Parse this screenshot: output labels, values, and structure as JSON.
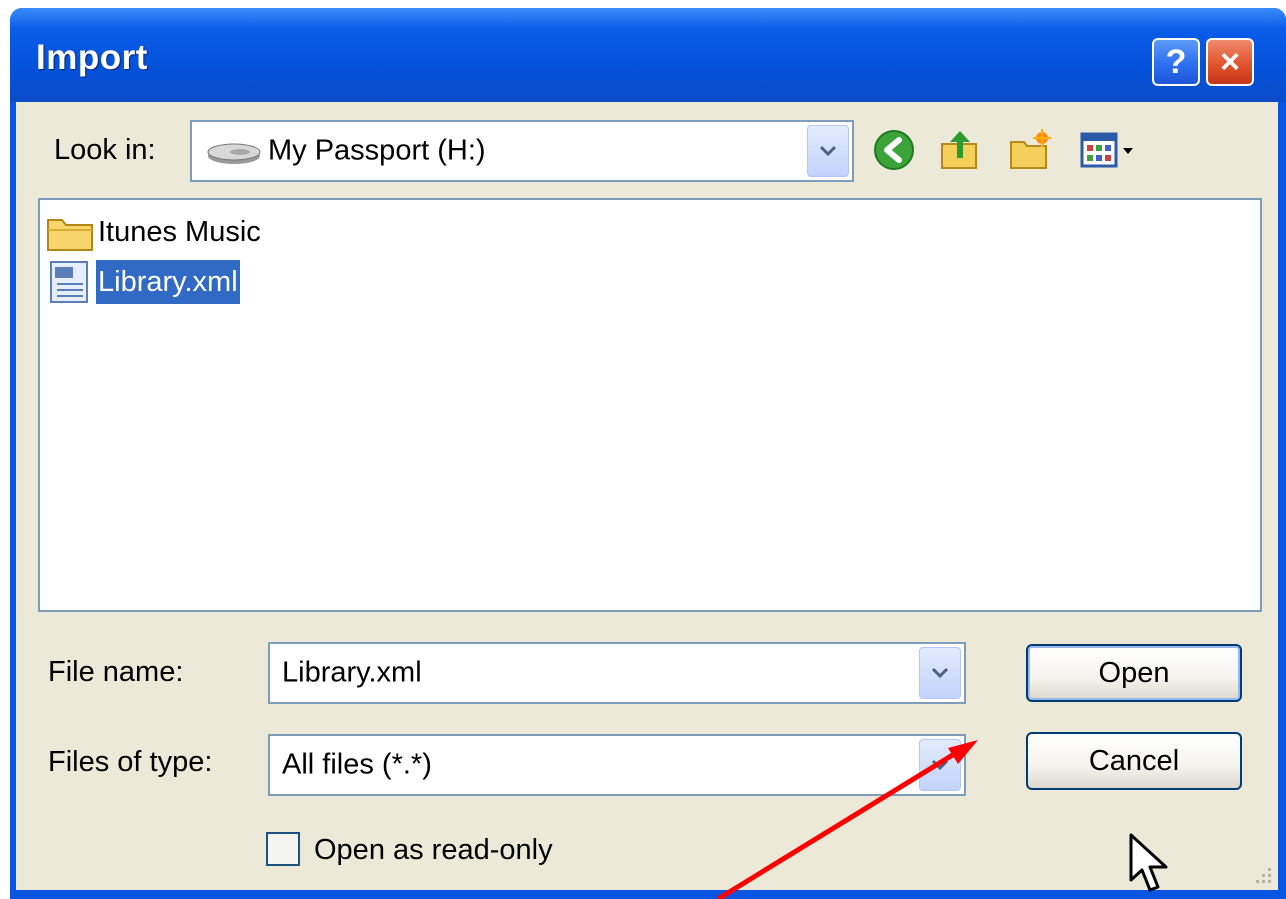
{
  "window": {
    "title": "Import",
    "help_label": "?",
    "close_label": "×"
  },
  "toolbar": {
    "look_in_label": "Look in:",
    "look_in_value": "My Passport (H:)",
    "drive_icon": "external-drive-icon",
    "icons": [
      "back-arrow-icon",
      "up-folder-icon",
      "new-folder-icon",
      "view-menu-icon"
    ]
  },
  "files": [
    {
      "name": "Itunes Music",
      "icon": "folder-icon",
      "selected": false
    },
    {
      "name": "Library.xml",
      "icon": "xml-file-icon",
      "selected": true
    }
  ],
  "form": {
    "file_name_label": "File name:",
    "file_name_value": "Library.xml",
    "file_type_label": "Files of type:",
    "file_type_value": "All files (*.*)",
    "readonly_label": "Open as read-only",
    "readonly_checked": false
  },
  "buttons": {
    "open": "Open",
    "cancel": "Cancel"
  },
  "colors": {
    "title_bar": "#0a54e2",
    "dialog_bg": "#ece9d8",
    "selection": "#316ac5",
    "annotation_arrow": "#ff0000"
  }
}
